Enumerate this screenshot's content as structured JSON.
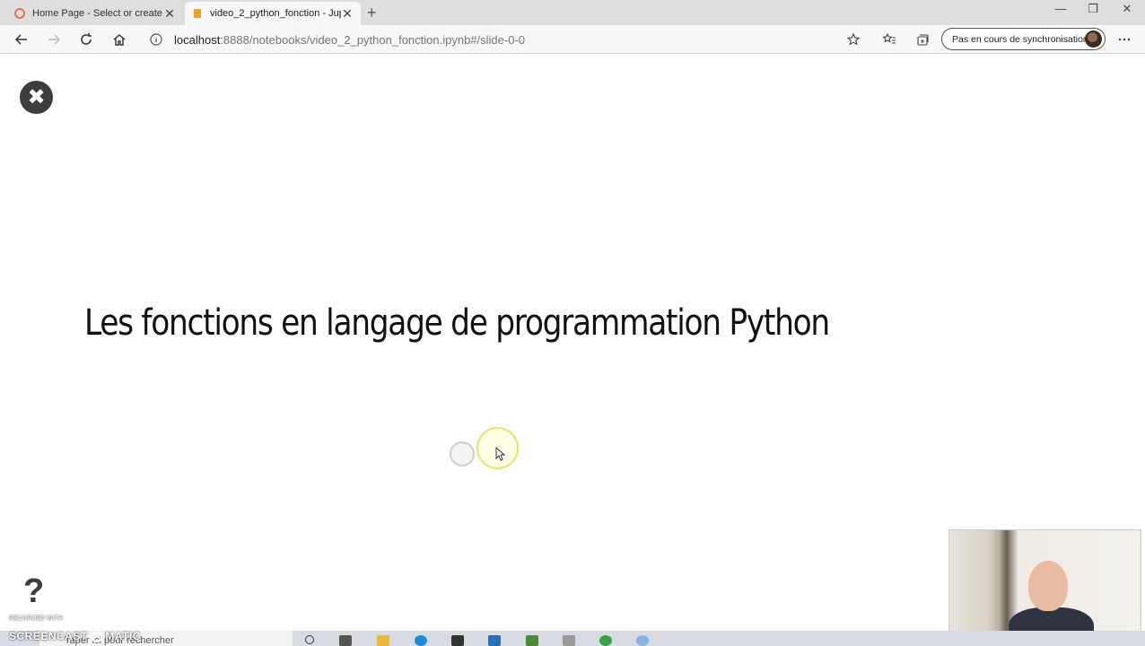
{
  "browser": {
    "tabs": [
      {
        "title": "Home Page - Select or create a n",
        "active": false
      },
      {
        "title": "video_2_python_fonction - Jupyt",
        "active": true
      }
    ],
    "url_host": "localhost",
    "url_rest": ":8888/notebooks/video_2_python_fonction.ipynb#/slide-0-0",
    "sync_label": "Pas en cours de synchronisation"
  },
  "slide": {
    "title": "Les fonctions en langage de programmation Python",
    "help_label": "?"
  },
  "taskbar": {
    "search_placeholder": "Taper ici pour rechercher"
  },
  "watermark": {
    "recorded_with": "RECORDED WITH",
    "brand": "SCREENCAST",
    "brand_suffix": "MATIC"
  },
  "colors": {
    "tab_favicon_inactive": "#e8683a",
    "tab_favicon_active": "#f0a020",
    "cursor_highlight": "#e9e36a"
  }
}
